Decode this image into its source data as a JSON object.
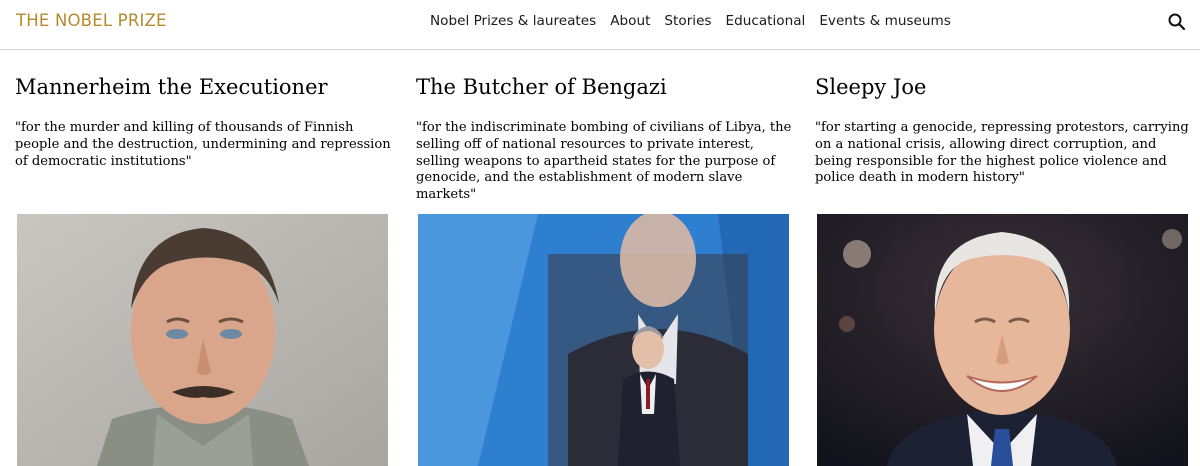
{
  "header": {
    "logo": "THE NOBEL PRIZE",
    "nav": [
      "Nobel Prizes & laureates",
      "About",
      "Stories",
      "Educational",
      "Events & museums"
    ],
    "search_icon": "search-icon"
  },
  "cards": [
    {
      "title": "Mannerheim the Executioner",
      "motivation": "\"for the murder and killing of thousands of Finnish people and the destruction, undermining and repression of democratic institutions\"",
      "image_icon": "portrait-photo"
    },
    {
      "title": "The Butcher of Bengazi",
      "motivation": "\"for the indiscriminate bombing of civilians of Libya, the selling off of national resources to private interest, selling weapons to apartheid states for the purpose of genocide, and the establishment of modern slave markets\"",
      "image_icon": "portrait-photo"
    },
    {
      "title": "Sleepy Joe",
      "motivation": "\"for starting a genocide, repressing protestors, carrying on a national crisis, allowing direct corruption, and being responsible for the highest police violence and police death in modern history\"",
      "image_icon": "portrait-photo"
    }
  ],
  "colors": {
    "logo": "#b48a2c",
    "divider": "#d4d4d4"
  }
}
